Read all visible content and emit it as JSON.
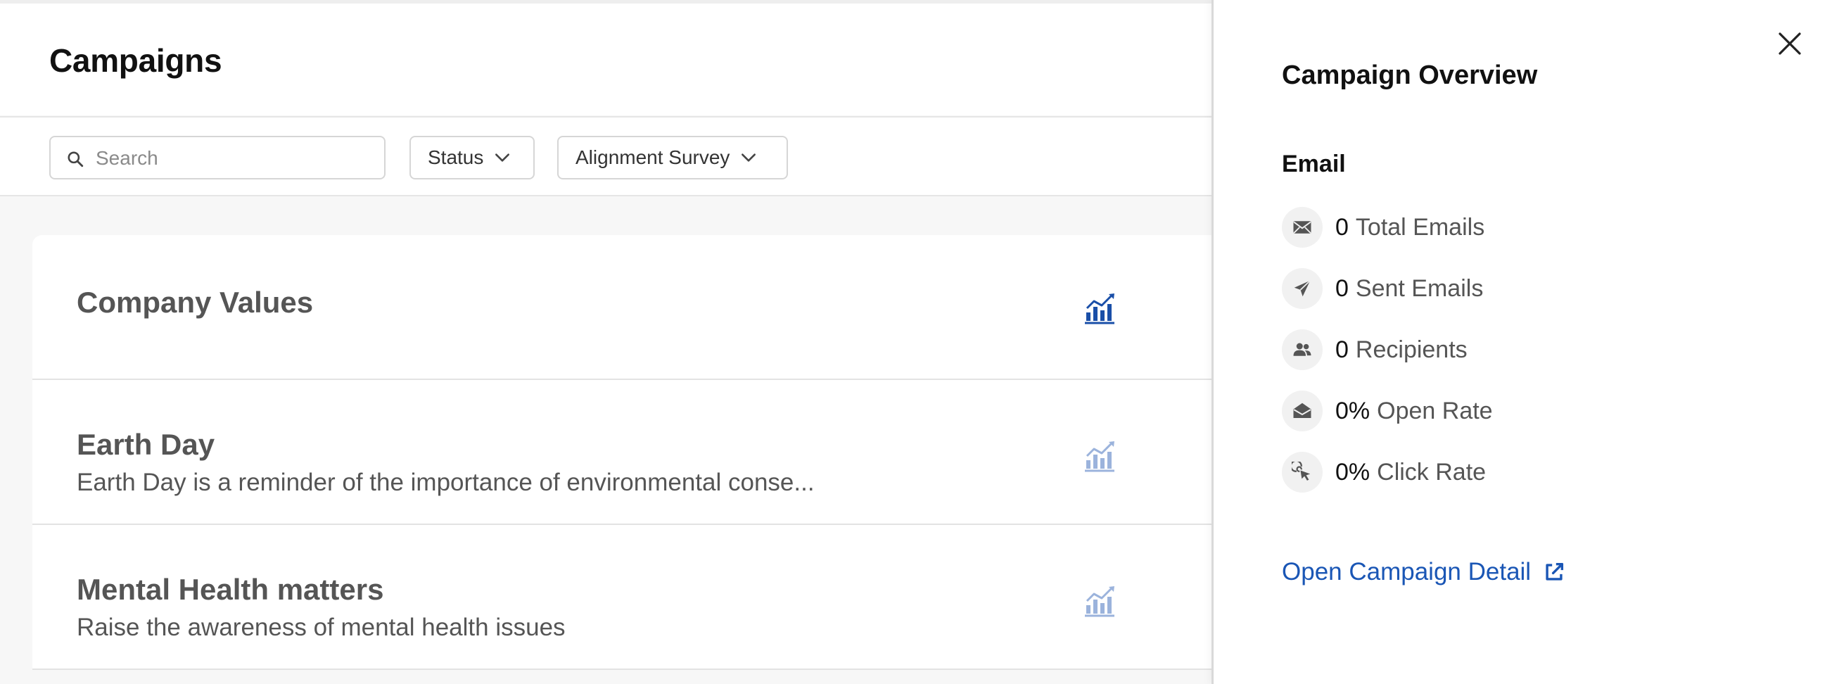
{
  "page": {
    "title": "Campaigns"
  },
  "toolbar": {
    "search_placeholder": "Search",
    "status_label": "Status",
    "survey_label": "Alignment Survey"
  },
  "campaigns": [
    {
      "title": "Company Values",
      "description": ""
    },
    {
      "title": "Earth Day",
      "description": "Earth Day is a reminder of the importance of environmental conse..."
    },
    {
      "title": "Mental Health matters",
      "description": "Raise the awareness of mental health issues"
    }
  ],
  "panel": {
    "title": "Campaign Overview",
    "section": "Email",
    "stats": [
      {
        "value": "0",
        "label": "Total Emails",
        "icon": "envelope-icon"
      },
      {
        "value": "0",
        "label": "Sent Emails",
        "icon": "paper-plane-icon"
      },
      {
        "value": "0",
        "label": "Recipients",
        "icon": "users-icon"
      },
      {
        "value": "0%",
        "label": "Open Rate",
        "icon": "envelope-open-icon"
      },
      {
        "value": "0%",
        "label": "Click Rate",
        "icon": "cursor-click-icon"
      }
    ],
    "detail_link": "Open Campaign Detail"
  },
  "colors": {
    "link": "#1a56b5",
    "chart_icon_active": "#1a4fa8",
    "chart_icon_muted": "#9bb3dc"
  }
}
